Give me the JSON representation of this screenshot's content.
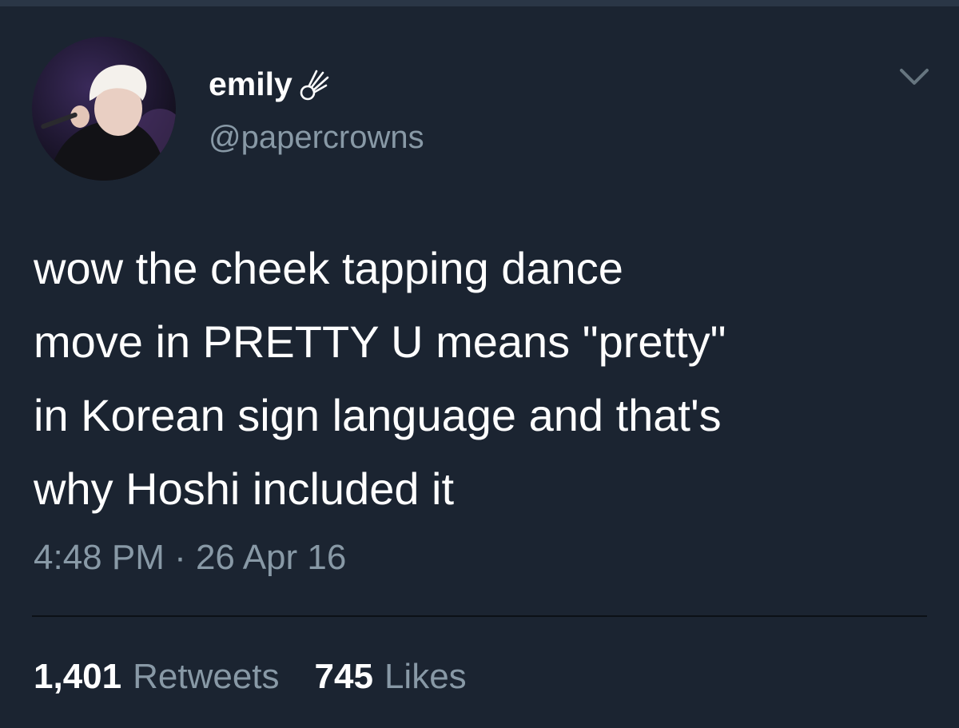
{
  "tweet": {
    "author": {
      "display_name": "emily",
      "name_emoji": "comet-emoji",
      "handle": "@papercrowns",
      "avatar": "profile-photo"
    },
    "menu_icon": "chevron-down-icon",
    "text_lines": [
      "wow the cheek tapping dance",
      "move in PRETTY U means \"pretty\"",
      "in Korean sign language and that's",
      "why Hoshi included it"
    ],
    "time": "4:48 PM",
    "date_separator": "·",
    "date": "26 Apr 16",
    "timestamp": "4:48 PM · 26 Apr 16",
    "stats": {
      "retweets_count": "1,401",
      "retweets_label": "Retweets",
      "likes_count": "745",
      "likes_label": "Likes"
    }
  },
  "colors": {
    "background": "#1b2431",
    "primary_text": "#ffffff",
    "secondary_text": "#8899a6",
    "divider": "#0b1016"
  }
}
